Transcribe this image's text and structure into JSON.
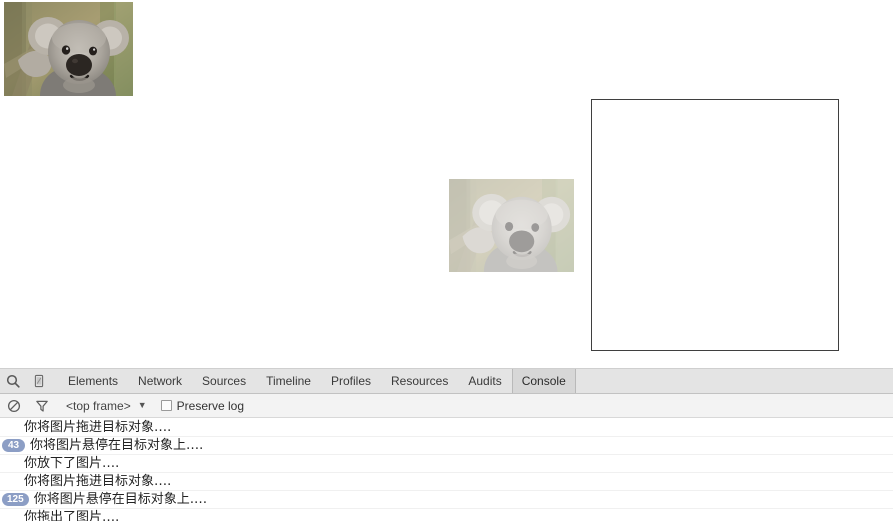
{
  "page": {
    "source_image": {
      "alt": "koala-photo",
      "name": "koala-source-image"
    },
    "drag_ghost": {
      "alt": "koala-photo-drag-ghost",
      "name": "koala-drag-ghost-image"
    },
    "drop_target": {
      "name": "drop-target-box",
      "label": ""
    }
  },
  "devtools": {
    "tabs": [
      {
        "label": "Elements",
        "active": false
      },
      {
        "label": "Network",
        "active": false
      },
      {
        "label": "Sources",
        "active": false
      },
      {
        "label": "Timeline",
        "active": false
      },
      {
        "label": "Profiles",
        "active": false
      },
      {
        "label": "Resources",
        "active": false
      },
      {
        "label": "Audits",
        "active": false
      },
      {
        "label": "Console",
        "active": true
      }
    ],
    "icons": {
      "inspect": "search-icon",
      "device": "device-toggle-icon",
      "clear": "clear-console-icon",
      "filter": "filter-funnel-icon"
    },
    "console_toolbar": {
      "frame_selector": "<top frame>",
      "frame_caret": "▼",
      "preserve_log_label": "Preserve log",
      "preserve_log_checked": false
    },
    "messages": [
      {
        "badge": null,
        "text": "你将图片拖进目标对象․․․․"
      },
      {
        "badge": "43",
        "text": "你将图片悬停在目标对象上․․․․"
      },
      {
        "badge": null,
        "text": "你放下了图片․․․․"
      },
      {
        "badge": null,
        "text": "你将图片拖进目标对象․․․․"
      },
      {
        "badge": "125",
        "text": "你将图片悬停在目标对象上․․․․"
      },
      {
        "badge": null,
        "text": "你拖出了图片․․․․"
      }
    ]
  },
  "colors": {
    "badge_bg": "#8c9ec5",
    "badge_text": "#ffffff",
    "tabbar_bg": "#e4e4e4",
    "active_tab_bg": "#d7d7d7",
    "toolbar_bg": "#f3f3f3",
    "drop_target_border": "#3f3f3f"
  }
}
